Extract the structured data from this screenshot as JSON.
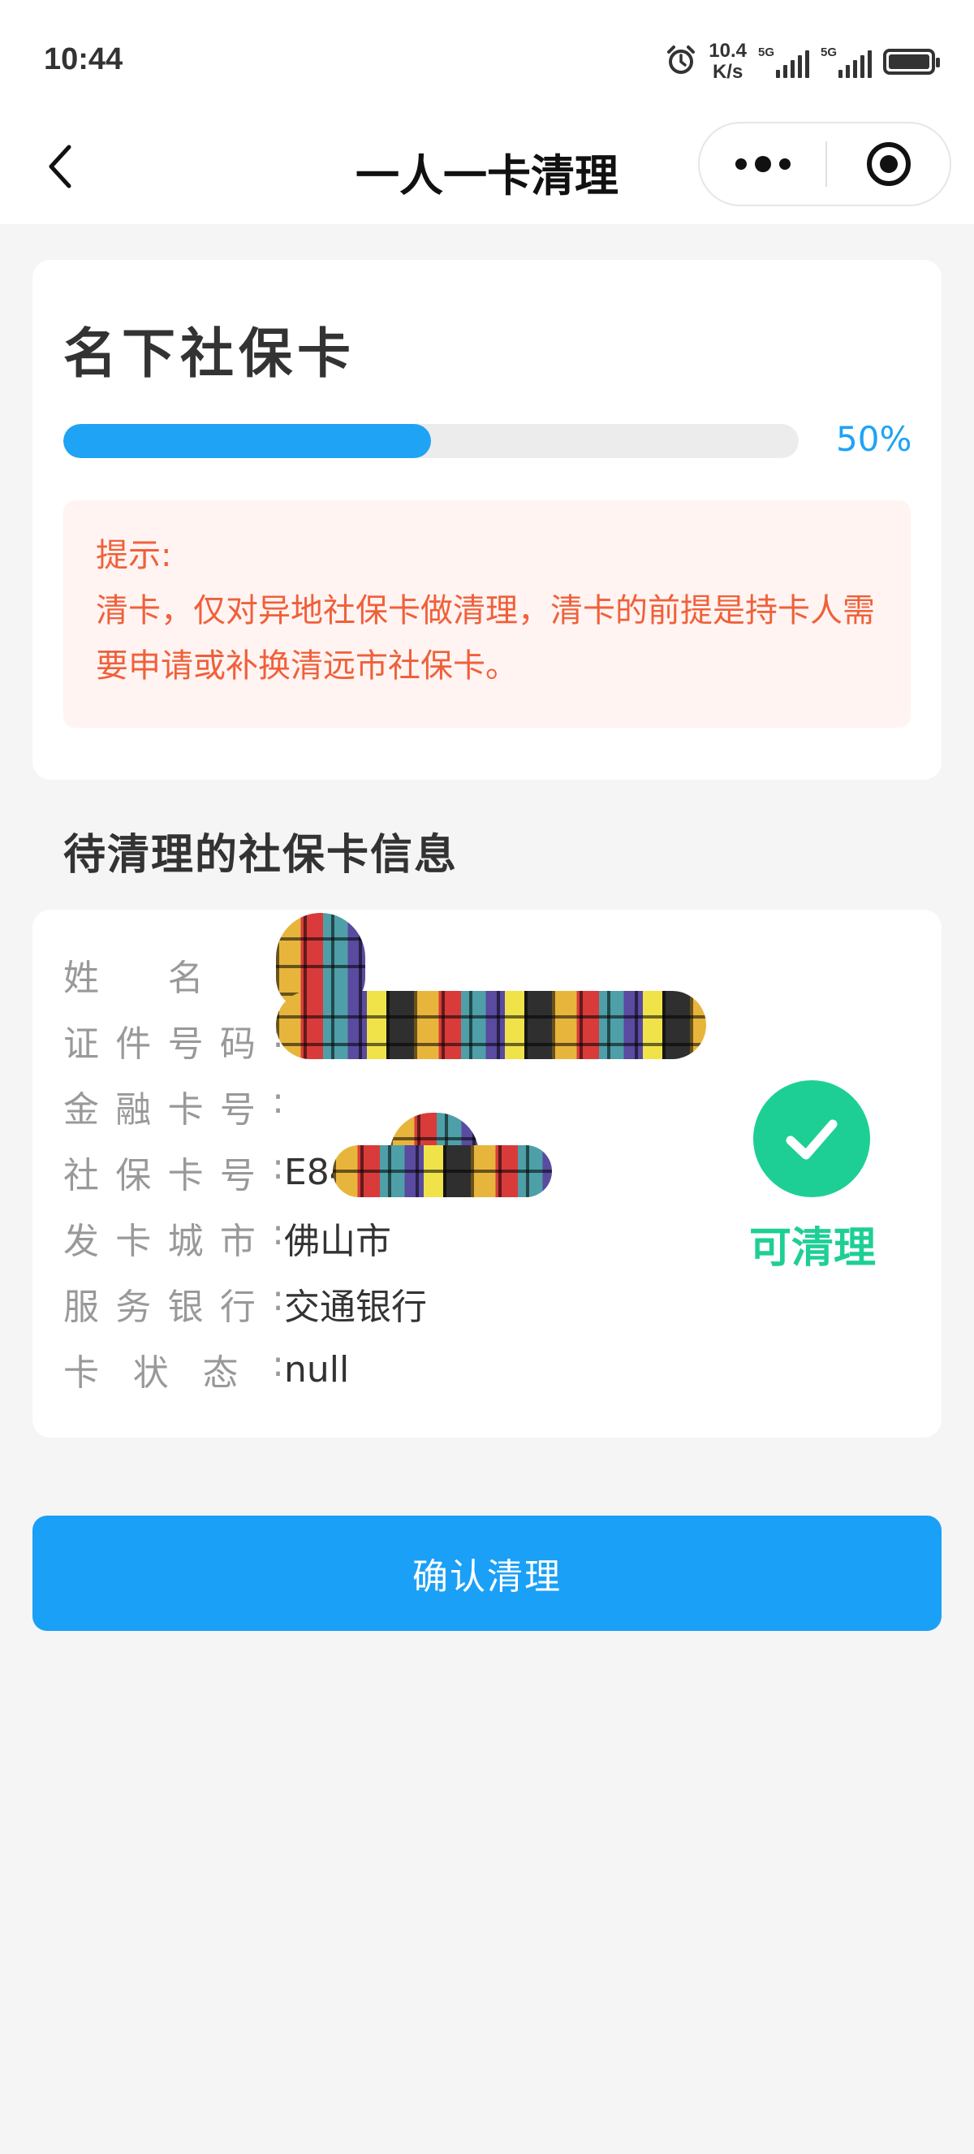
{
  "status_bar": {
    "time": "10:44",
    "net_speed_value": "10.4",
    "net_speed_unit": "K/s",
    "signal_1_label": "5G",
    "signal_2_label": "5G",
    "alarm_icon": "alarm-icon",
    "battery_icon": "battery-icon"
  },
  "nav": {
    "title": "一人一卡清理",
    "back_icon": "chevron-left-icon",
    "more_icon": "more-dots-icon",
    "close_icon": "target-circle-icon"
  },
  "summary_card": {
    "title": "名下社保卡",
    "progress_percent": 50,
    "progress_text": "50%",
    "tip_label": "提示:",
    "tip_text": "清卡，仅对异地社保卡做清理，清卡的前提是持卡人需要申请或补换清远市社保卡。"
  },
  "section_title": "待清理的社保卡信息",
  "card_info": {
    "rows": [
      {
        "label": "姓名:",
        "value": ""
      },
      {
        "label": "证件号码:",
        "value": ""
      },
      {
        "label": "金融卡号:",
        "value": ""
      },
      {
        "label": "社保卡号:",
        "value": "E84"
      },
      {
        "label": "发卡城市:",
        "value": "佛山市"
      },
      {
        "label": "服务银行:",
        "value": "交通银行"
      },
      {
        "label": "卡状态:",
        "value": "null"
      }
    ],
    "status_icon": "check-circle-icon",
    "status_text": "可清理",
    "status_color": "#1ecf95"
  },
  "confirm_button": {
    "label": "确认清理",
    "color": "#1aa0f7"
  }
}
